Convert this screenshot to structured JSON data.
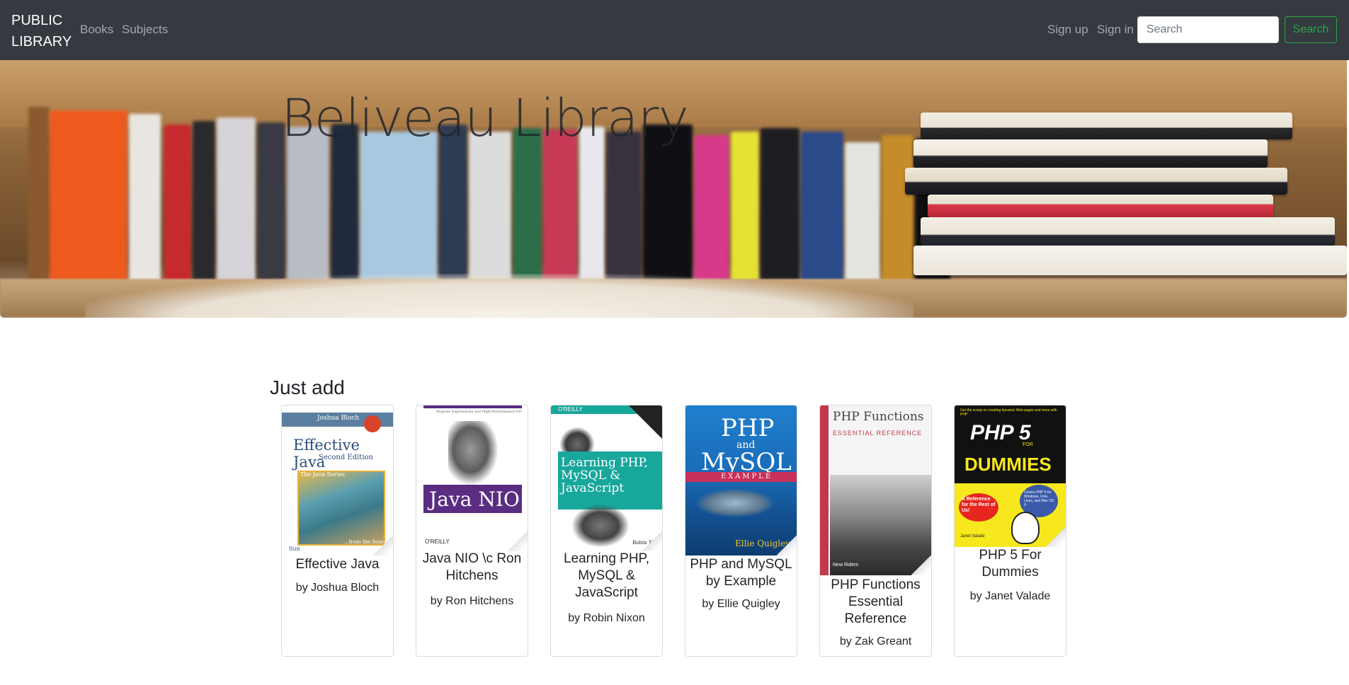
{
  "navbar": {
    "brand": "PUBLIC LIBRARY",
    "links": {
      "books": "Books",
      "subjects": "Subjects",
      "signup": "Sign up",
      "signin": "Sign in"
    },
    "search": {
      "placeholder": "Search",
      "button_label": "Search"
    },
    "colors": {
      "background": "#343a40",
      "search_button": "#28a745"
    }
  },
  "hero": {
    "title": "Beliveau Library"
  },
  "section": {
    "title": "Just add"
  },
  "books": [
    {
      "title": "Effective Java",
      "author": "by Joshua Bloch",
      "cover": {
        "author": "Joshua Bloch",
        "title": "Effective Java",
        "edition": "Second Edition",
        "series": "The Java Series",
        "tagline": "...from the Source",
        "publisher": "Sun"
      }
    },
    {
      "title": "Java NIO \\c Ron Hitchens",
      "author": "by Ron Hitchens",
      "cover": {
        "tagline": "Regular Expressions and High-Performance I/O",
        "title": "Java NIO",
        "publisher": "O'REILLY"
      }
    },
    {
      "title": "Learning PHP, MySQL & JavaScript",
      "author": "by Robin Nixon",
      "cover": {
        "publisher": "O'REILLY",
        "title": "Learning PHP, MySQL & JavaScript",
        "author": "Robin N"
      }
    },
    {
      "title": "PHP and MySQL by Example",
      "author": "by Ellie Quigley",
      "cover": {
        "title_top": "PHP",
        "title_mid": "and",
        "title_bottom": "MySQL",
        "band": "EXAMPLE",
        "author": "Ellie Quigley"
      }
    },
    {
      "title": "PHP Functions Essential Reference",
      "author": "by Zak Greant",
      "cover": {
        "title": "PHP Functions",
        "subtitle": "ESSENTIAL REFERENCE",
        "publisher": "New Riders"
      }
    },
    {
      "title": "PHP 5 For Dummies",
      "author": "by Janet Valade",
      "cover": {
        "tagline": "Get the scoop on creating dynamic Web pages and more with PHP",
        "title": "PHP 5",
        "for": "FOR",
        "dummies": "DUMMIES",
        "badge": "A Reference for the Rest of Us!",
        "covers": "Covers PHP 5 for Windows, Unix, Linux, and Mac OS X",
        "author": "Janet Valade"
      }
    }
  ]
}
